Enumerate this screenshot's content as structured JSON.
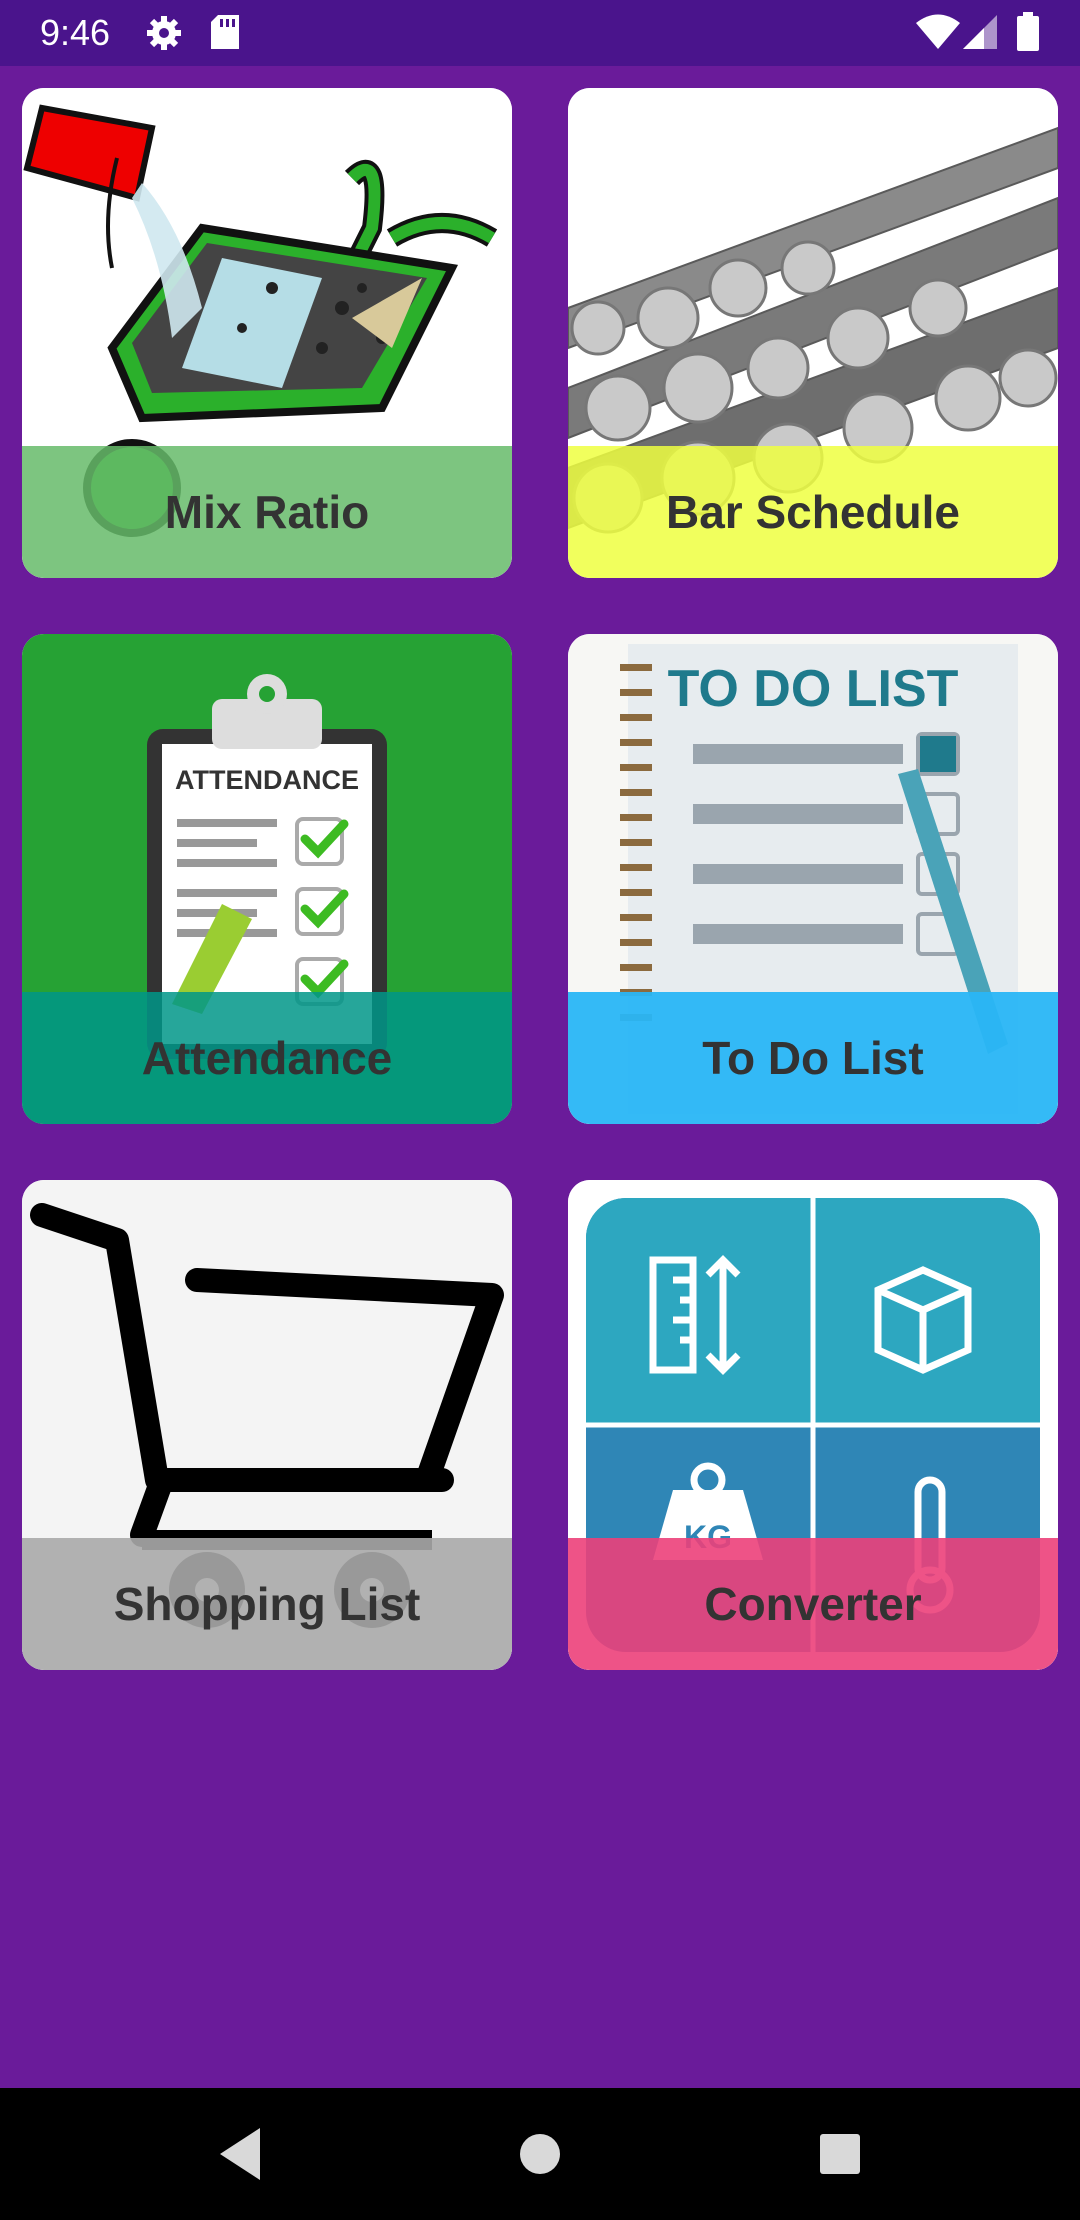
{
  "status_bar": {
    "time": "9:46",
    "icons": [
      "settings-icon",
      "sd-card-icon",
      "wifi-icon",
      "signal-icon",
      "battery-icon"
    ]
  },
  "tiles": [
    {
      "label": "Mix Ratio",
      "overlay": "rgba(102,187,106,0.85)",
      "icon": "wheelbarrow-concrete-image"
    },
    {
      "label": "Bar Schedule",
      "overlay": "rgba(238,255,65,0.85)",
      "icon": "steel-rebar-image"
    },
    {
      "label": "Attendance",
      "overlay": "rgba(0,150,136,0.85)",
      "icon": "attendance-clipboard-image",
      "image_text": "ATTENDANCE"
    },
    {
      "label": "To Do List",
      "overlay": "rgba(41,182,246,0.95)",
      "icon": "todo-notepad-image",
      "image_text": "TO DO LIST"
    },
    {
      "label": "Shopping List",
      "overlay": "rgba(170,170,170,0.9)",
      "icon": "shopping-cart-image"
    },
    {
      "label": "Converter",
      "overlay": "rgba(236,64,122,0.9)",
      "icon": "unit-converter-image",
      "image_text": "KG"
    }
  ],
  "navigation": {
    "buttons": [
      "back-button",
      "home-button",
      "recents-button"
    ]
  },
  "colors": {
    "background": "#6a1b9a",
    "status_bar": "#4a148c",
    "nav_bar": "#000000"
  }
}
